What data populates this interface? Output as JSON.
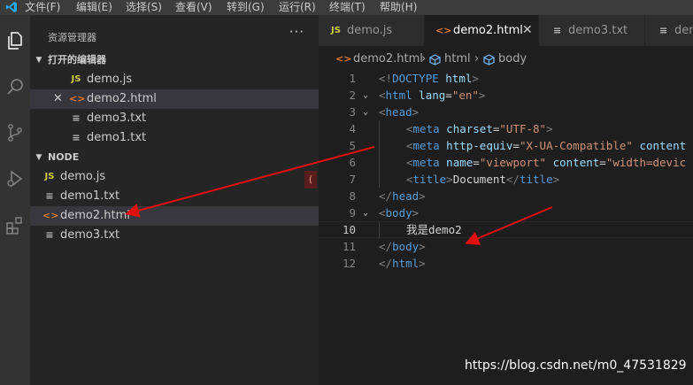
{
  "menubar": {
    "items": [
      "文件(F)",
      "编辑(E)",
      "选择(S)",
      "查看(V)",
      "转到(G)",
      "运行(R)",
      "终端(T)",
      "帮助(H)"
    ]
  },
  "activity_bar": {
    "icons": [
      "files-icon",
      "search-icon",
      "source-control-icon",
      "run-debug-icon",
      "extensions-icon"
    ]
  },
  "sidebar": {
    "title": "资源管理器",
    "more": "···",
    "open_editors": {
      "header": "打开的编辑器",
      "items": [
        {
          "badge": "JS",
          "label": "demo.js"
        },
        {
          "badge": "<>",
          "label": "demo2.html",
          "close": "✕"
        },
        {
          "badge": "≡",
          "label": "demo3.txt"
        },
        {
          "badge": "≡",
          "label": "demo1.txt"
        }
      ]
    },
    "folder": {
      "header": "NODE",
      "items": [
        {
          "badge": "JS",
          "label": "demo.js"
        },
        {
          "badge": "≡",
          "label": "demo1.txt"
        },
        {
          "badge": "<>",
          "label": "demo2.html"
        },
        {
          "badge": "≡",
          "label": "demo3.txt"
        }
      ]
    },
    "problem_badge": "("
  },
  "tabs": [
    {
      "badge": "JS",
      "label": "demo.js"
    },
    {
      "badge": "<>",
      "label": "demo2.html",
      "close": "✕"
    },
    {
      "badge": "≡",
      "label": "demo3.txt"
    },
    {
      "badge": "≡",
      "label": "dem"
    }
  ],
  "breadcrumb": {
    "file": "demo2.html",
    "sep1": "›",
    "node1": "html",
    "sep2": "›",
    "node2": "body"
  },
  "editor": {
    "current_line": 10,
    "lines": [
      {
        "n": "1",
        "fold": "",
        "indent": 0,
        "segments": [
          [
            "br",
            "<!"
          ],
          [
            "tg",
            "DOCTYPE"
          ],
          [
            "pl",
            " "
          ],
          [
            "at",
            "html"
          ],
          [
            "br",
            ">"
          ]
        ]
      },
      {
        "n": "2",
        "fold": "⌄",
        "indent": 0,
        "segments": [
          [
            "br",
            "<"
          ],
          [
            "tg",
            "html"
          ],
          [
            "pl",
            " "
          ],
          [
            "at",
            "lang"
          ],
          [
            "pl",
            "="
          ],
          [
            "st",
            "\"en\""
          ],
          [
            "br",
            ">"
          ]
        ]
      },
      {
        "n": "3",
        "fold": "⌄",
        "indent": 0,
        "segments": [
          [
            "br",
            "<"
          ],
          [
            "tg",
            "head"
          ],
          [
            "br",
            ">"
          ]
        ]
      },
      {
        "n": "4",
        "fold": "",
        "indent": 1,
        "segments": [
          [
            "br",
            "<"
          ],
          [
            "tg",
            "meta"
          ],
          [
            "pl",
            " "
          ],
          [
            "at",
            "charset"
          ],
          [
            "pl",
            "="
          ],
          [
            "st",
            "\"UTF-8\""
          ],
          [
            "br",
            ">"
          ]
        ]
      },
      {
        "n": "5",
        "fold": "",
        "indent": 1,
        "segments": [
          [
            "br",
            "<"
          ],
          [
            "tg",
            "meta"
          ],
          [
            "pl",
            " "
          ],
          [
            "at",
            "http-equiv"
          ],
          [
            "pl",
            "="
          ],
          [
            "st",
            "\"X-UA-Compatible\""
          ],
          [
            "pl",
            " "
          ],
          [
            "at",
            "content"
          ]
        ]
      },
      {
        "n": "6",
        "fold": "",
        "indent": 1,
        "segments": [
          [
            "br",
            "<"
          ],
          [
            "tg",
            "meta"
          ],
          [
            "pl",
            " "
          ],
          [
            "at",
            "name"
          ],
          [
            "pl",
            "="
          ],
          [
            "st",
            "\"viewport\""
          ],
          [
            "pl",
            " "
          ],
          [
            "at",
            "content"
          ],
          [
            "pl",
            "="
          ],
          [
            "st",
            "\"width=devic"
          ]
        ]
      },
      {
        "n": "7",
        "fold": "",
        "indent": 1,
        "segments": [
          [
            "br",
            "<"
          ],
          [
            "tg",
            "title"
          ],
          [
            "br",
            ">"
          ],
          [
            "pl",
            "Document"
          ],
          [
            "br",
            "</"
          ],
          [
            "tg",
            "title"
          ],
          [
            "br",
            ">"
          ]
        ]
      },
      {
        "n": "8",
        "fold": "",
        "indent": 0,
        "segments": [
          [
            "br",
            "</"
          ],
          [
            "tg",
            "head"
          ],
          [
            "br",
            ">"
          ]
        ]
      },
      {
        "n": "9",
        "fold": "⌄",
        "indent": 0,
        "segments": [
          [
            "br",
            "<"
          ],
          [
            "tg",
            "body"
          ],
          [
            "br",
            ">"
          ]
        ]
      },
      {
        "n": "10",
        "fold": "",
        "indent": 1,
        "segments": [
          [
            "pl",
            "我是demo2"
          ]
        ]
      },
      {
        "n": "11",
        "fold": "",
        "indent": 0,
        "segments": [
          [
            "br",
            "</"
          ],
          [
            "tg",
            "body"
          ],
          [
            "br",
            ">"
          ]
        ]
      },
      {
        "n": "12",
        "fold": "",
        "indent": 0,
        "segments": [
          [
            "br",
            "</"
          ],
          [
            "tg",
            "html"
          ],
          [
            "br",
            ">"
          ]
        ]
      }
    ]
  },
  "watermark": "https://blog.csdn.net/m0_47531829",
  "colors": {
    "annotation_arrow": "#e01010",
    "accent": "#007acc",
    "html_icon": "#e37933",
    "js_icon": "#cbcb41"
  }
}
